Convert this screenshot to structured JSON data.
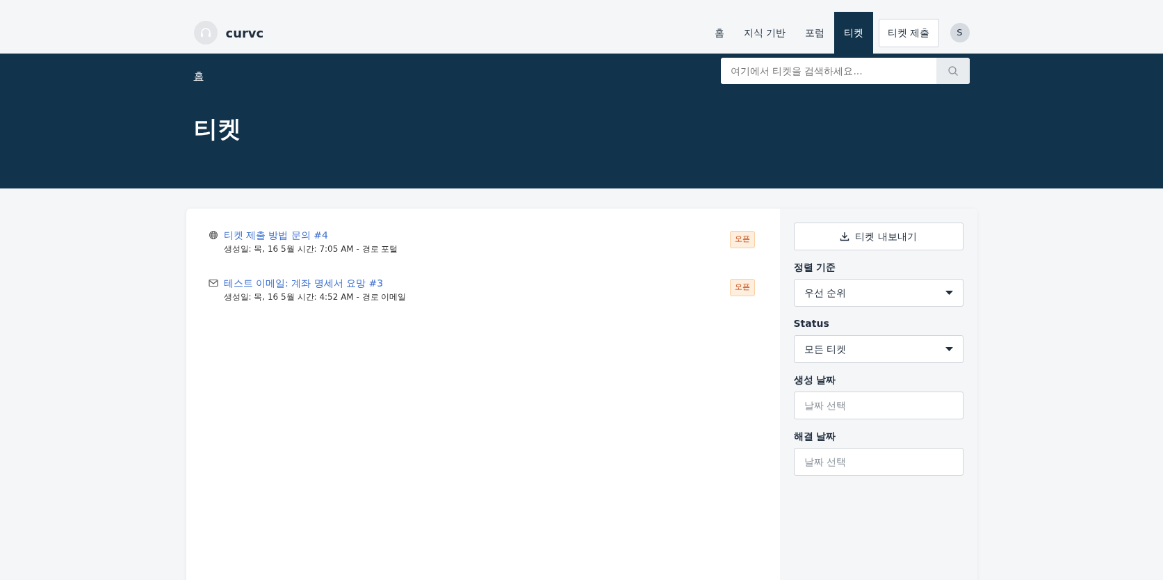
{
  "brand": {
    "name": "curvc"
  },
  "nav": [
    {
      "label": "홈",
      "selected": false,
      "kind": "link"
    },
    {
      "label": "지식 기반",
      "selected": false,
      "kind": "link"
    },
    {
      "label": "포럼",
      "selected": false,
      "kind": "link"
    },
    {
      "label": "티켓",
      "selected": true,
      "kind": "link"
    },
    {
      "label": "티켓 제출",
      "selected": false,
      "kind": "button"
    }
  ],
  "user": {
    "initial": "S"
  },
  "breadcrumb": [
    "홈"
  ],
  "search": {
    "placeholder": "여기에서 티켓을 검색하세요..."
  },
  "page_title": "티켓",
  "tickets": [
    {
      "kind": "web",
      "title": "티켓 제출 방법 문의 #4",
      "meta": "생성일: 목, 16 5월 시간: 7:05 AM - 경로 포털",
      "status": "오픈"
    },
    {
      "kind": "email",
      "title": "테스트 이메일: 계좌 명세서 요망 #3",
      "meta": "생성일: 목, 16 5월 시간: 4:52 AM - 경로 이메일",
      "status": "오픈"
    }
  ],
  "export_button": "티켓 내보내기",
  "filters": [
    {
      "kind": "select",
      "label": "정렬 기준",
      "value": "우선 순위"
    },
    {
      "kind": "select",
      "label": "Status",
      "value": "모든 티켓"
    },
    {
      "kind": "date",
      "label": "생성 날짜",
      "placeholder": "날짜 선택"
    },
    {
      "kind": "date",
      "label": "해결 날짜",
      "placeholder": "날짜 선택"
    }
  ]
}
